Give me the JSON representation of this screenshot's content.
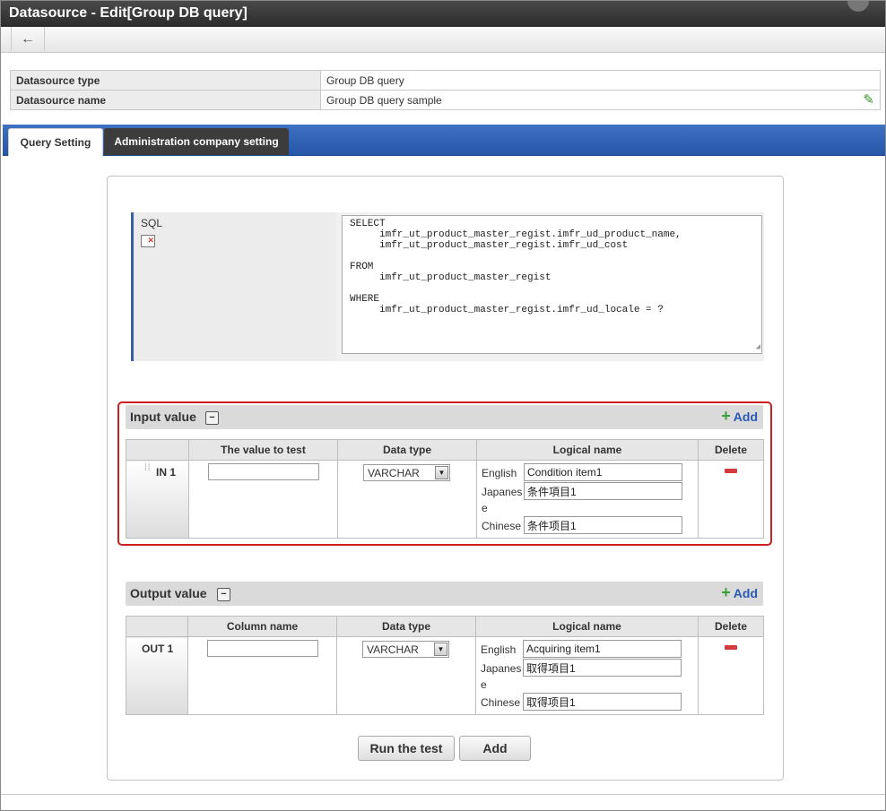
{
  "window": {
    "title": "Datasource - Edit[Group DB query]"
  },
  "toolbar": {
    "back_icon": "←"
  },
  "info": [
    {
      "label": "Datasource type",
      "value": "Group DB query"
    },
    {
      "label": "Datasource name",
      "value": "Group DB query sample",
      "edit_icon": "pencil-icon"
    }
  ],
  "tabs": [
    {
      "label": "Query Setting",
      "active": true
    },
    {
      "label": "Administration company setting",
      "active": false
    }
  ],
  "sql": {
    "label": "SQL",
    "text": "SELECT\n     imfr_ut_product_master_regist.imfr_ud_product_name,\n     imfr_ut_product_master_regist.imfr_ud_cost\n\nFROM\n     imfr_ut_product_master_regist\n\nWHERE\n     imfr_ut_product_master_regist.imfr_ud_locale = ?"
  },
  "input_section": {
    "title": "Input value",
    "add_label": "Add",
    "columns": [
      "",
      "The value to test",
      "Data type",
      "Logical name",
      "Delete"
    ],
    "row": {
      "label": "IN 1",
      "test_value": "",
      "data_type": "VARCHAR",
      "logical": {
        "english_label": "English",
        "english_value": "Condition item1",
        "japanese_label_1": "Japanes",
        "japanese_label_2": "e",
        "japanese_value": "条件項目1",
        "chinese_label": "Chinese",
        "chinese_value": "条件项目1"
      }
    }
  },
  "output_section": {
    "title": "Output value",
    "add_label": "Add",
    "columns": [
      "",
      "Column name",
      "Data type",
      "Logical name",
      "Delete"
    ],
    "row": {
      "label": "OUT 1",
      "column_name": "",
      "data_type": "VARCHAR",
      "logical": {
        "english_label": "English",
        "english_value": "Acquiring item1",
        "japanese_label_1": "Japanes",
        "japanese_label_2": "e",
        "japanese_value": "取得項目1",
        "chinese_label": "Chinese",
        "chinese_value": "取得项目1"
      }
    }
  },
  "buttons": {
    "run_test": "Run the test",
    "add": "Add"
  },
  "colors": {
    "tab_bar": "#2556a8",
    "highlight_border": "#cc1f1f",
    "add_link": "#2a58b5",
    "plus_icon": "#3aa13a",
    "delete_icon": "#d23c3c"
  }
}
